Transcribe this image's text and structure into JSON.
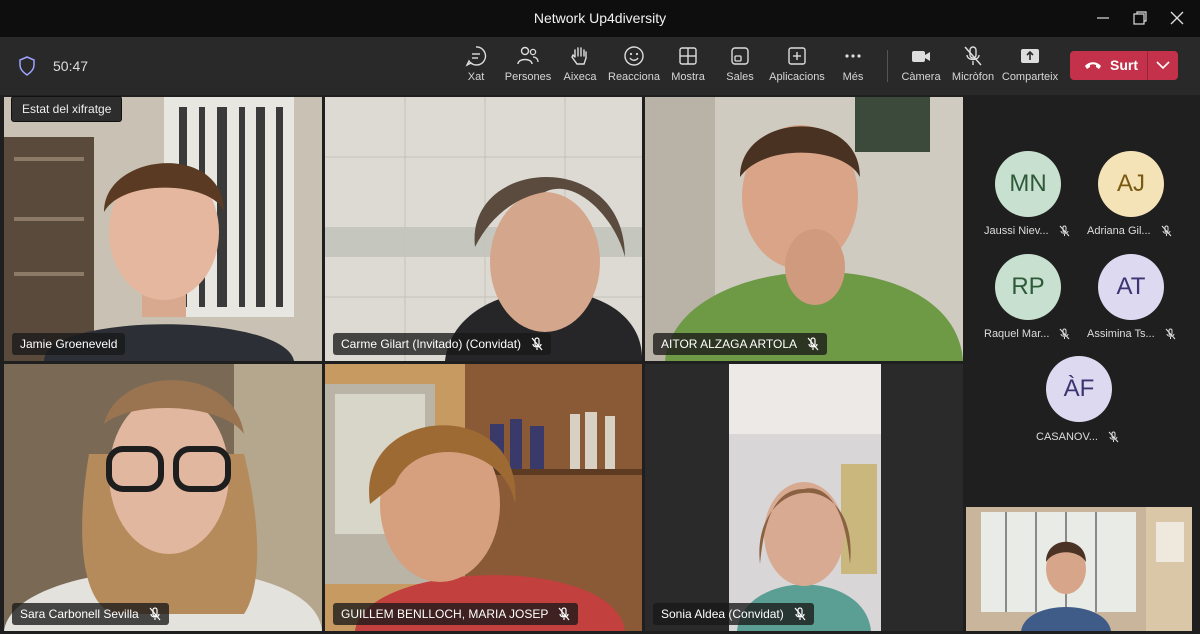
{
  "window": {
    "title": "Network Up4diversity"
  },
  "toolbar": {
    "timer": "50:47",
    "buttons": [
      {
        "label": "Xat",
        "icon": "chat-icon"
      },
      {
        "label": "Persones",
        "icon": "people-icon"
      },
      {
        "label": "Aixeca",
        "icon": "raise-hand-icon"
      },
      {
        "label": "Reacciona",
        "icon": "smile-icon"
      },
      {
        "label": "Mostra",
        "icon": "grid-icon"
      },
      {
        "label": "Sales",
        "icon": "rooms-icon"
      },
      {
        "label": "Aplicacions",
        "icon": "plus-icon"
      },
      {
        "label": "Més",
        "icon": "more-icon"
      },
      {
        "label": "Càmera",
        "icon": "camera-icon"
      },
      {
        "label": "Micròfon",
        "icon": "mic-off-icon"
      },
      {
        "label": "Comparteix",
        "icon": "share-icon"
      }
    ],
    "leave_label": "Surt"
  },
  "tooltip": "Estat del xifratge",
  "tiles": [
    {
      "name": "Jamie Groeneveld",
      "muted": false
    },
    {
      "name": "Carme Gilart (Invitado) (Convidat)",
      "muted": true
    },
    {
      "name": "AITOR ALZAGA ARTOLA",
      "muted": true
    },
    {
      "name": "Sara Carbonell Sevilla",
      "muted": true
    },
    {
      "name": "GUILLEM BENLLOCH, MARIA JOSEP",
      "muted": true
    },
    {
      "name": "Sonia Aldea (Convidat)",
      "muted": true
    }
  ],
  "gallery": [
    {
      "initials": "MN",
      "name": "Jaussi Niev...",
      "bg": "#c8e0cf",
      "fg": "#2e5a3a"
    },
    {
      "initials": "AJ",
      "name": "Adriana Gil...",
      "bg": "#f5e3b8",
      "fg": "#7a5a12"
    },
    {
      "initials": "RP",
      "name": "Raquel Mar...",
      "bg": "#c8e0cf",
      "fg": "#2e5a3a"
    },
    {
      "initials": "AT",
      "name": "Assimina Ts...",
      "bg": "#dcd9f0",
      "fg": "#3c3570"
    },
    {
      "initials": "ÀF",
      "name": "CASANOV...",
      "bg": "#dcd9f0",
      "fg": "#3c3570"
    }
  ],
  "colors": {
    "leave": "#c4314b",
    "active_speaker": "#7f85f5"
  }
}
